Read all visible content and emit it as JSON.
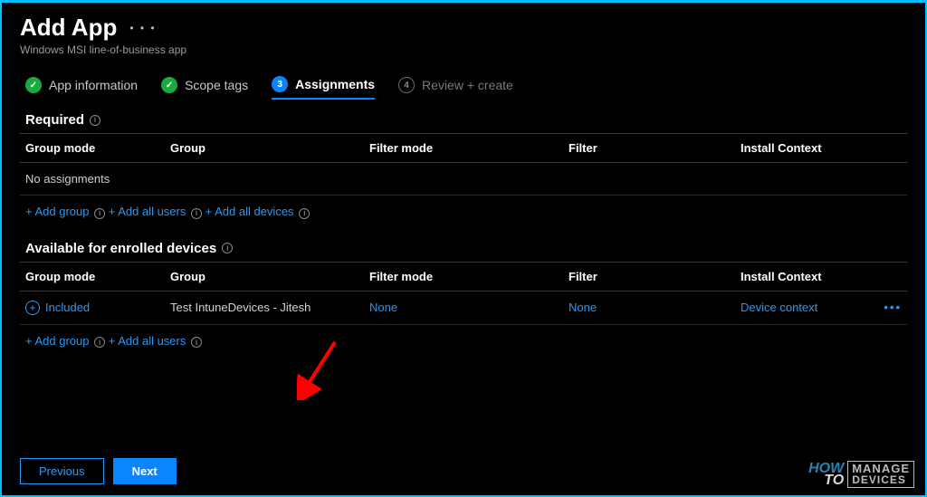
{
  "header": {
    "title": "Add App",
    "subtitle": "Windows MSI line-of-business app"
  },
  "stepper": {
    "step1": "App information",
    "step2": "Scope tags",
    "step3_num": "3",
    "step3": "Assignments",
    "step4_num": "4",
    "step4": "Review + create"
  },
  "sections": {
    "required": {
      "title": "Required",
      "empty": "No assignments"
    },
    "available": {
      "title": "Available for enrolled devices"
    }
  },
  "columns": {
    "mode": "Group mode",
    "group": "Group",
    "fmode": "Filter mode",
    "filter": "Filter",
    "ctx": "Install Context"
  },
  "actions": {
    "add_group": "+ Add group",
    "add_all_users": "+ Add all users",
    "add_all_devices": "+ Add all devices"
  },
  "row": {
    "mode": "Included",
    "group": "Test IntuneDevices - Jitesh",
    "fmode": "None",
    "filter": "None",
    "ctx": "Device context"
  },
  "footer": {
    "prev": "Previous",
    "next": "Next"
  },
  "watermark": {
    "how": "HOW",
    "to": "TO",
    "l1": "MANAGE",
    "l2": "DEVICES"
  }
}
